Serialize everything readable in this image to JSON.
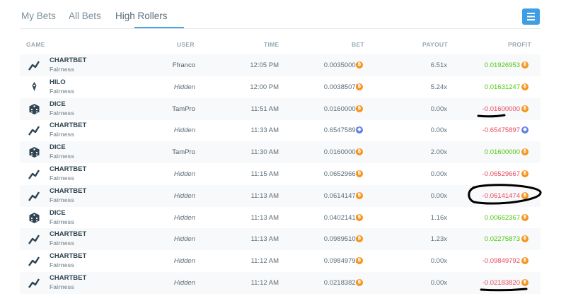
{
  "tabs": [
    {
      "label": "My Bets"
    },
    {
      "label": "All Bets"
    },
    {
      "label": "High Rollers"
    }
  ],
  "active_tab": "High Rollers",
  "headers": {
    "game": "GAME",
    "user": "USER",
    "time": "TIME",
    "bet": "BET",
    "payout": "PAYOUT",
    "profit": "PROFIT"
  },
  "colors": {
    "accent": "#3e9ee3",
    "positive": "#4ec90f",
    "negative": "#e84a5f",
    "btc": "#f7931a",
    "eth": "#627eea"
  },
  "rows": [
    {
      "game": "CHARTBET",
      "icon": "chart-line-icon",
      "sub": "Fairness",
      "user": "Ffranco",
      "hidden": false,
      "time": "12:05 PM",
      "bet": "0.00350000",
      "currency": "btc",
      "payout": "6.51x",
      "profit": "0.01926953",
      "positive": true
    },
    {
      "game": "HILO",
      "icon": "hilo-icon",
      "sub": "Fairness",
      "user": "Hidden",
      "hidden": true,
      "time": "12:00 PM",
      "bet": "0.00385075",
      "currency": "btc",
      "payout": "5.24x",
      "profit": "0.01631247",
      "positive": true
    },
    {
      "game": "DICE",
      "icon": "dice-icon",
      "sub": "Fairness",
      "user": "TamPro",
      "hidden": false,
      "time": "11:51 AM",
      "bet": "0.01600000",
      "currency": "btc",
      "payout": "0.00x",
      "profit": "-0.01600000",
      "positive": false
    },
    {
      "game": "CHARTBET",
      "icon": "chart-line-icon",
      "sub": "Fairness",
      "user": "Hidden",
      "hidden": true,
      "time": "11:33 AM",
      "bet": "0.65475897",
      "currency": "eth",
      "payout": "0.00x",
      "profit": "-0.65475897",
      "positive": false
    },
    {
      "game": "DICE",
      "icon": "dice-icon",
      "sub": "Fairness",
      "user": "TamPro",
      "hidden": false,
      "time": "11:30 AM",
      "bet": "0.01600000",
      "currency": "btc",
      "payout": "2.00x",
      "profit": "0.01600000",
      "positive": true
    },
    {
      "game": "CHARTBET",
      "icon": "chart-line-icon",
      "sub": "Fairness",
      "user": "Hidden",
      "hidden": true,
      "time": "11:15 AM",
      "bet": "0.06529667",
      "currency": "btc",
      "payout": "0.00x",
      "profit": "-0.06529667",
      "positive": false
    },
    {
      "game": "CHARTBET",
      "icon": "chart-line-icon",
      "sub": "Fairness",
      "user": "Hidden",
      "hidden": true,
      "time": "11:13 AM",
      "bet": "0.06141474",
      "currency": "btc",
      "payout": "0.00x",
      "profit": "-0.06141474",
      "positive": false
    },
    {
      "game": "DICE",
      "icon": "dice-icon",
      "sub": "Fairness",
      "user": "Hidden",
      "hidden": true,
      "time": "11:13 AM",
      "bet": "0.04021415",
      "currency": "btc",
      "payout": "1.16x",
      "profit": "0.00662367",
      "positive": true
    },
    {
      "game": "CHARTBET",
      "icon": "chart-line-icon",
      "sub": "Fairness",
      "user": "Hidden",
      "hidden": true,
      "time": "11:13 AM",
      "bet": "0.09895101",
      "currency": "btc",
      "payout": "1.23x",
      "profit": "0.02275873",
      "positive": true
    },
    {
      "game": "CHARTBET",
      "icon": "chart-line-icon",
      "sub": "Fairness",
      "user": "Hidden",
      "hidden": true,
      "time": "11:12 AM",
      "bet": "0.09849792",
      "currency": "btc",
      "payout": "0.00x",
      "profit": "-0.09849792",
      "positive": false
    },
    {
      "game": "CHARTBET",
      "icon": "chart-line-icon",
      "sub": "Fairness",
      "user": "Hidden",
      "hidden": true,
      "time": "11:12 AM",
      "bet": "0.02183820",
      "currency": "btc",
      "payout": "0.00x",
      "profit": "-0.02183820",
      "positive": false
    }
  ]
}
